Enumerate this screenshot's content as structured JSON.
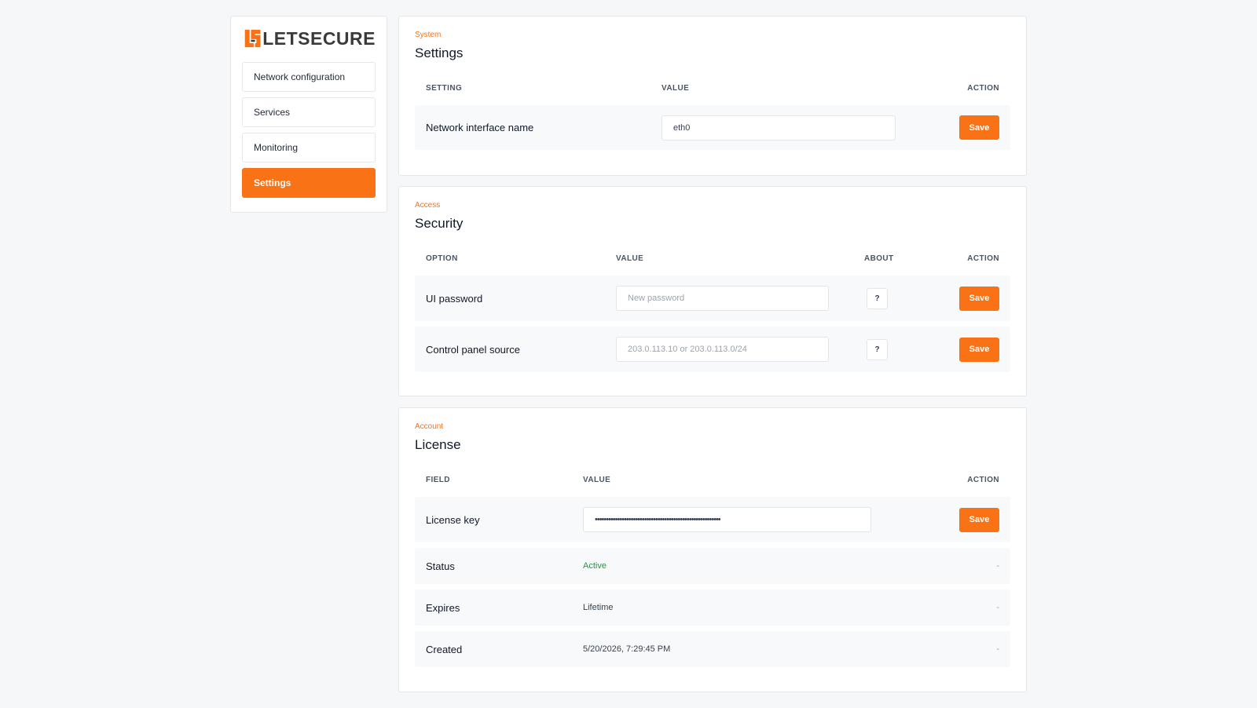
{
  "brand": {
    "name": "LETSECURE",
    "accent": "#f97316"
  },
  "sidebar": {
    "items": [
      {
        "label": "Network configuration"
      },
      {
        "label": "Services"
      },
      {
        "label": "Monitoring"
      },
      {
        "label": "Settings",
        "active": true
      }
    ]
  },
  "system": {
    "eyebrow": "System",
    "title": "Settings",
    "headers": {
      "setting": "SETTING",
      "value": "VALUE",
      "action": "ACTION"
    },
    "rows": [
      {
        "label": "Network interface name",
        "value": "eth0",
        "action": "Save"
      }
    ]
  },
  "access": {
    "eyebrow": "Access",
    "title": "Security",
    "headers": {
      "option": "OPTION",
      "value": "VALUE",
      "about": "ABOUT",
      "action": "ACTION"
    },
    "rows": [
      {
        "label": "UI password",
        "placeholder": "New password",
        "about": "?",
        "action": "Save"
      },
      {
        "label": "Control panel source",
        "placeholder": "203.0.113.10 or 203.0.113.0/24",
        "about": "?",
        "action": "Save"
      }
    ]
  },
  "account": {
    "eyebrow": "Account",
    "title": "License",
    "headers": {
      "field": "FIELD",
      "value": "VALUE",
      "action": "ACTION"
    },
    "license_key": {
      "label": "License key",
      "value": "••••••••••••••••••••••••••••••••••••••••••••••••••••••••",
      "action": "Save"
    },
    "status": {
      "label": "Status",
      "value": "Active",
      "action": "-"
    },
    "expires": {
      "label": "Expires",
      "value": "Lifetime",
      "action": "-"
    },
    "created": {
      "label": "Created",
      "value": "5/20/2026, 7:29:45 PM",
      "action": "-"
    }
  },
  "colors": {
    "active_status": "#2f8f46"
  }
}
